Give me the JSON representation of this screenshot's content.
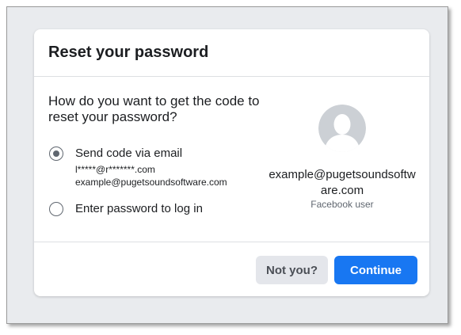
{
  "dialog": {
    "title": "Reset your password",
    "question": "How do you want to get the code to reset your password?"
  },
  "options": [
    {
      "label": "Send code via email",
      "selected": true,
      "details": [
        "l*****@r*******.com",
        "example@pugetsoundsoftware.com"
      ]
    },
    {
      "label": "Enter password to log in",
      "selected": false,
      "details": []
    }
  ],
  "profile": {
    "avatar_icon": "default-user-avatar-icon",
    "email": "example@pugetsoundsoftware.com",
    "role": "Facebook user"
  },
  "buttons": {
    "not_you": "Not you?",
    "continue": "Continue"
  },
  "colors": {
    "primary": "#1877f2",
    "secondary_button": "#e4e6eb",
    "background": "#e9ebee",
    "avatar": "#ccd0d5"
  }
}
